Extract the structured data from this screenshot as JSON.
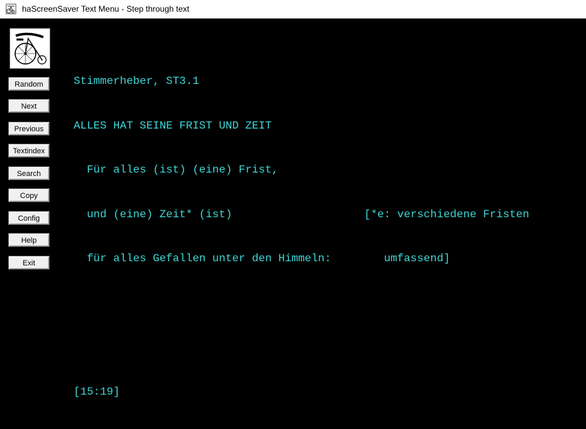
{
  "window": {
    "title": "haScreenSaver Text Menu - Step through text"
  },
  "sidebar": {
    "buttons": [
      {
        "id": "random",
        "label": "Random"
      },
      {
        "id": "next",
        "label": "Next"
      },
      {
        "id": "previous",
        "label": "Previous"
      },
      {
        "id": "textindex",
        "label": "Textindex"
      },
      {
        "id": "search",
        "label": "Search"
      },
      {
        "id": "copy",
        "label": "Copy"
      },
      {
        "id": "config",
        "label": "Config"
      },
      {
        "id": "help",
        "label": "Help"
      },
      {
        "id": "exit",
        "label": "Exit"
      }
    ]
  },
  "main": {
    "lines": [
      "Stimmerheber, ST3.1",
      "ALLES HAT SEINE FRIST UND ZEIT",
      "  Für alles (ist) (eine) Frist,",
      "  und (eine) Zeit* (ist)                    [*e: verschiedene Fristen",
      "  für alles Gefallen unter den Himmeln:        umfassend]"
    ],
    "reference": "[15:19]"
  },
  "colors": {
    "text": "#3fd6d6",
    "background": "#000000"
  }
}
